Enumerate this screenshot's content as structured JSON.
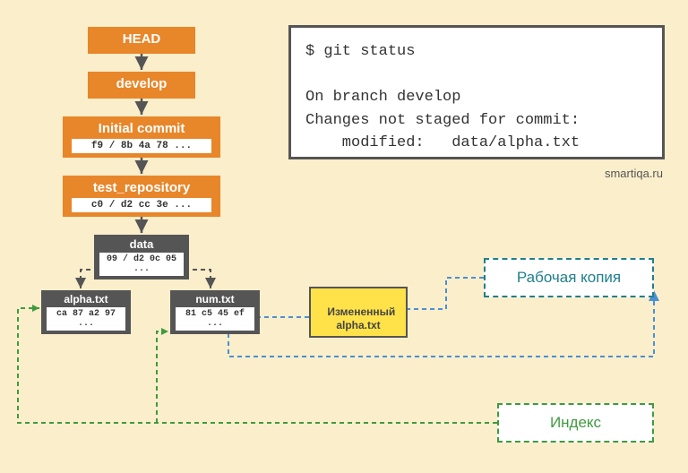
{
  "nodes": {
    "head": {
      "title": "HEAD"
    },
    "develop": {
      "title": "develop"
    },
    "initial": {
      "title": "Initial commit",
      "hash": "f9 / 8b 4a 78 ..."
    },
    "repo": {
      "title": "test_repository",
      "hash": "c0 / d2 cc 3e ..."
    },
    "data": {
      "title": "data",
      "hash": "09 / d2 0c 05 ..."
    },
    "alpha": {
      "title": "alpha.txt",
      "hash": "ca 87 a2 97 ..."
    },
    "num": {
      "title": "num.txt",
      "hash": "81 c5 45 ef ..."
    },
    "modified": {
      "title": "Измененный\nalpha.txt"
    }
  },
  "labels": {
    "working_copy": "Рабочая копия",
    "index": "Индекс"
  },
  "terminal": {
    "cmd": "$ git status",
    "line1": "On branch develop",
    "line2": "Changes not staged for commit:",
    "line3": "    modified:   data/alpha.txt"
  },
  "watermark": "smartiqa.ru",
  "colors": {
    "orange": "#e8862a",
    "gray": "#555555",
    "yellow": "#ffe24a",
    "teal": "#1f7f8b",
    "green": "#3f9a3f",
    "blue": "#4a8fd6"
  }
}
